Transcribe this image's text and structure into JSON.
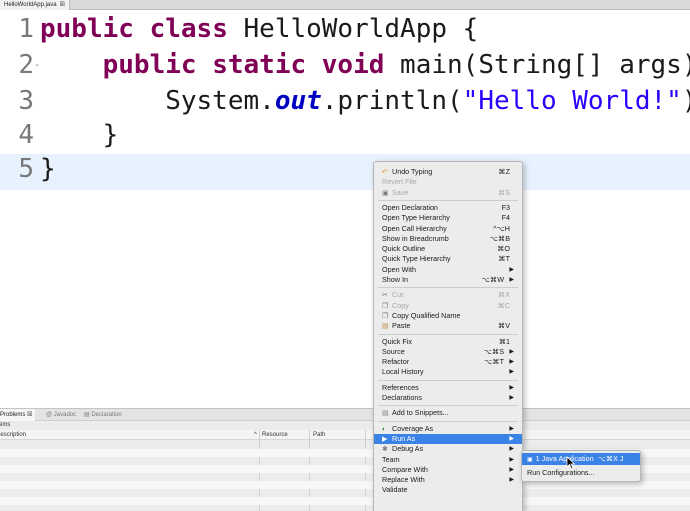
{
  "editor_tab": {
    "title": "HelloWorldApp.java",
    "close": "☒"
  },
  "code_lines": [
    {
      "num": "1",
      "parts": [
        {
          "t": "kw",
          "v": "public"
        },
        {
          "t": "p",
          "v": " "
        },
        {
          "t": "kw",
          "v": "class"
        },
        {
          "t": "p",
          "v": " HelloWorldApp {"
        }
      ]
    },
    {
      "num": "2",
      "marker": "-",
      "parts": [
        {
          "t": "p",
          "v": "    "
        },
        {
          "t": "kw",
          "v": "public"
        },
        {
          "t": "p",
          "v": " "
        },
        {
          "t": "kw",
          "v": "static"
        },
        {
          "t": "p",
          "v": " "
        },
        {
          "t": "kw",
          "v": "void"
        },
        {
          "t": "p",
          "v": " main(String[] args) {"
        }
      ]
    },
    {
      "num": "3",
      "parts": [
        {
          "t": "p",
          "v": "        System."
        },
        {
          "t": "fld",
          "v": "out"
        },
        {
          "t": "p",
          "v": ".println("
        },
        {
          "t": "str",
          "v": "\"Hello World!\""
        },
        {
          "t": "p",
          "v": ");"
        }
      ]
    },
    {
      "num": "4",
      "parts": [
        {
          "t": "p",
          "v": "    }"
        }
      ]
    },
    {
      "num": "5",
      "parts": [
        {
          "t": "p",
          "v": "}"
        }
      ]
    }
  ],
  "panel": {
    "tabs": [
      {
        "label": "Problems",
        "icon": "☒"
      },
      {
        "label": "Javadoc",
        "icon": "@"
      },
      {
        "label": "Declaration",
        "icon": "▤"
      }
    ],
    "sub_label": "items",
    "columns": {
      "description": "Description",
      "resource": "Resource",
      "path": "Path",
      "sort_indicator": "^"
    }
  },
  "context_menu": {
    "items": [
      {
        "label": "Undo Typing",
        "shortcut": "⌘Z",
        "icon": "undo-icon",
        "glyph": "↶"
      },
      {
        "label": "Revert File",
        "shortcut": "",
        "disabled": true
      },
      {
        "label": "Save",
        "shortcut": "⌘S",
        "disabled": true,
        "icon": "save-icon",
        "glyph": "▣"
      },
      {
        "sep": true
      },
      {
        "label": "Open Declaration",
        "shortcut": "F3"
      },
      {
        "label": "Open Type Hierarchy",
        "shortcut": "F4"
      },
      {
        "label": "Open Call Hierarchy",
        "shortcut": "^⌥H"
      },
      {
        "label": "Show in Breadcrumb",
        "shortcut": "⌥⌘B"
      },
      {
        "label": "Quick Outline",
        "shortcut": "⌘O"
      },
      {
        "label": "Quick Type Hierarchy",
        "shortcut": "⌘T"
      },
      {
        "label": "Open With",
        "submenu": true
      },
      {
        "label": "Show In",
        "shortcut": "⌥⌘W",
        "submenu": true
      },
      {
        "sep": true
      },
      {
        "label": "Cut",
        "shortcut": "⌘X",
        "disabled": true,
        "icon": "cut-icon",
        "glyph": "✂"
      },
      {
        "label": "Copy",
        "shortcut": "⌘C",
        "disabled": true,
        "icon": "copy-icon",
        "glyph": "❐"
      },
      {
        "label": "Copy Qualified Name",
        "shortcut": "",
        "icon": "copy-qualified-icon",
        "glyph": "❐"
      },
      {
        "label": "Paste",
        "shortcut": "⌘V",
        "icon": "paste-icon",
        "glyph": "▤"
      },
      {
        "sep": true
      },
      {
        "label": "Quick Fix",
        "shortcut": "⌘1"
      },
      {
        "label": "Source",
        "shortcut": "⌥⌘S",
        "submenu": true
      },
      {
        "label": "Refactor",
        "shortcut": "⌥⌘T",
        "submenu": true
      },
      {
        "label": "Local History",
        "submenu": true
      },
      {
        "sep": true
      },
      {
        "label": "References",
        "submenu": true
      },
      {
        "label": "Declarations",
        "submenu": true
      },
      {
        "sep": true
      },
      {
        "label": "Add to Snippets...",
        "icon": "snippet-icon",
        "glyph": "▤"
      },
      {
        "sep": true
      },
      {
        "label": "Coverage As",
        "submenu": true,
        "icon": "coverage-icon",
        "glyph": "◐"
      },
      {
        "label": "Run As",
        "submenu": true,
        "highlighted": true,
        "icon": "run-icon",
        "glyph": "▶"
      },
      {
        "label": "Debug As",
        "submenu": true,
        "icon": "debug-icon",
        "glyph": "✱"
      },
      {
        "label": "Team",
        "submenu": true
      },
      {
        "label": "Compare With",
        "submenu": true
      },
      {
        "label": "Replace With",
        "submenu": true
      },
      {
        "label": "Validate",
        "submenu": false
      }
    ]
  },
  "run_as_submenu": {
    "items": [
      {
        "label": "1 Java Application",
        "shortcut": "⌥⌘X J",
        "highlighted": true,
        "icon": "java-app-icon",
        "glyph": "▣"
      },
      {
        "label": "Run Configurations..."
      }
    ]
  },
  "colors": {
    "keyword": "#7f0055",
    "string": "#2a00ff",
    "field": "#0000c0",
    "highlight": "#3b82e6",
    "current_line": "#e8f2fe"
  }
}
